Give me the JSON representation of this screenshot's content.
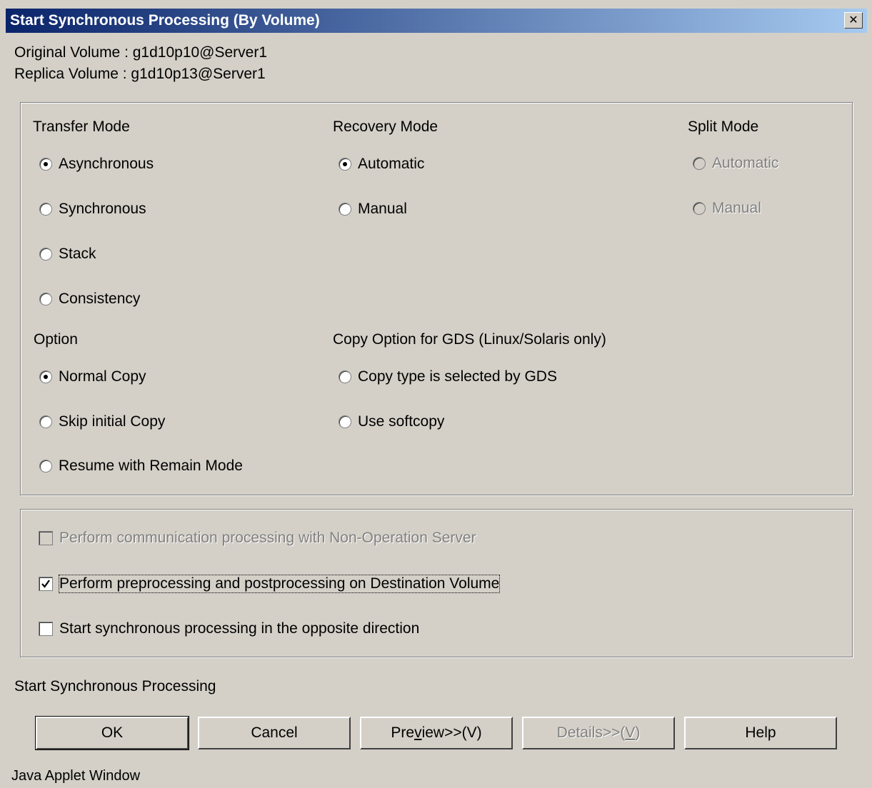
{
  "window": {
    "title": "Start Synchronous Processing (By Volume)",
    "close_glyph": "✕"
  },
  "info": {
    "original_volume": "Original Volume : g1d10p10@Server1",
    "replica_volume": "Replica Volume : g1d10p13@Server1"
  },
  "transfer_mode": {
    "label": "Transfer Mode",
    "options": [
      {
        "label": "Asynchronous",
        "selected": true
      },
      {
        "label": "Synchronous",
        "selected": false
      },
      {
        "label": "Stack",
        "selected": false
      },
      {
        "label": "Consistency",
        "selected": false
      }
    ]
  },
  "recovery_mode": {
    "label": "Recovery Mode",
    "options": [
      {
        "label": "Automatic",
        "selected": true
      },
      {
        "label": "Manual",
        "selected": false
      }
    ]
  },
  "split_mode": {
    "label": "Split Mode",
    "options": [
      {
        "label": "Automatic",
        "selected": false,
        "disabled": true
      },
      {
        "label": "Manual",
        "selected": false,
        "disabled": true
      }
    ]
  },
  "option": {
    "label": "Option",
    "options": [
      {
        "label": "Normal Copy",
        "selected": true
      },
      {
        "label": "Skip initial Copy",
        "selected": false
      },
      {
        "label": "Resume with Remain Mode",
        "selected": false
      }
    ]
  },
  "gds_copy_option": {
    "label": "Copy Option for GDS (Linux/Solaris only)",
    "options": [
      {
        "label": "Copy type is selected by GDS",
        "selected": false
      },
      {
        "label": "Use softcopy",
        "selected": false
      }
    ]
  },
  "checkboxes": [
    {
      "label": "Perform communication processing with Non-Operation Server",
      "checked": false,
      "disabled": true
    },
    {
      "label": "Perform preprocessing and postprocessing on Destination Volume",
      "checked": true,
      "disabled": false
    },
    {
      "label": "Start synchronous processing in the opposite direction",
      "checked": false,
      "disabled": false
    }
  ],
  "status_text": "Start Synchronous Processing",
  "buttons": {
    "ok": "OK",
    "cancel": "Cancel",
    "preview_pre": "Pre",
    "preview_mnemonic": "v",
    "preview_post": "iew>>(V)",
    "details_pre": "Details>>(",
    "details_mnemonic": "V",
    "details_post": ")",
    "help": "Help"
  },
  "footer": "Java Applet Window"
}
